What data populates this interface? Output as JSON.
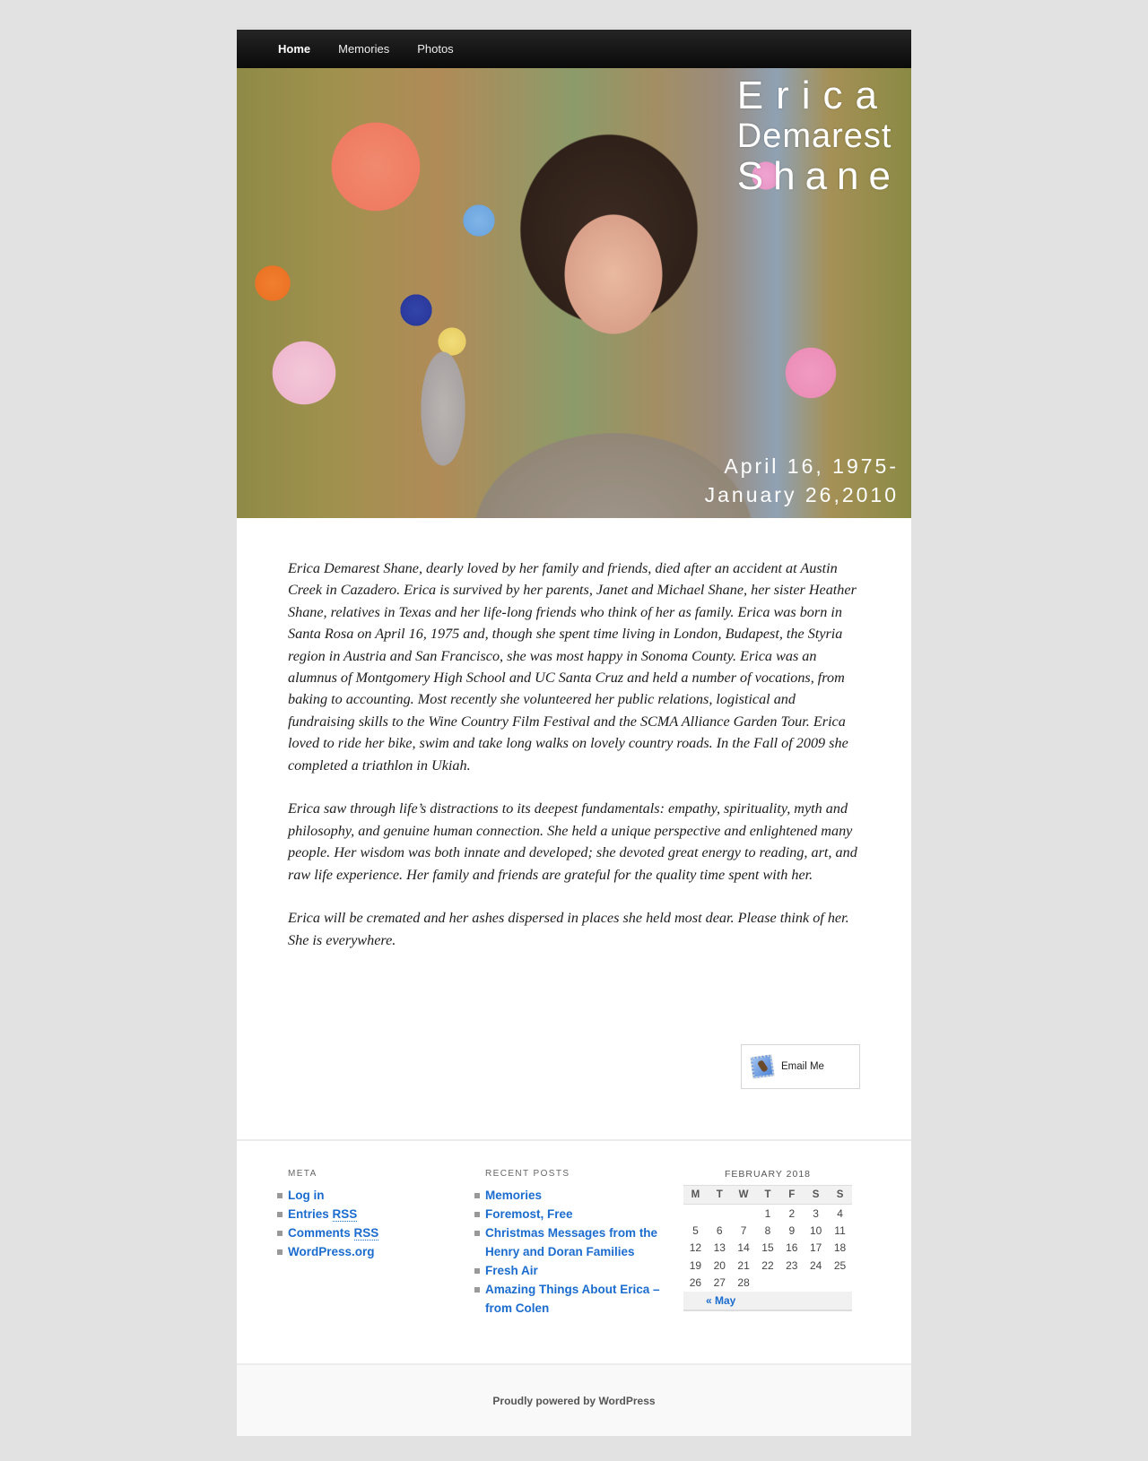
{
  "nav": {
    "items": [
      {
        "label": "Home",
        "current": true
      },
      {
        "label": "Memories",
        "current": false
      },
      {
        "label": "Photos",
        "current": false
      }
    ]
  },
  "header": {
    "title_line1": "Erica",
    "title_line2": "Demarest",
    "title_line3": "Shane",
    "dates_line1": "April 16, 1975-",
    "dates_line2": "January 26,2010"
  },
  "content": {
    "paragraphs": [
      "Erica Demarest Shane, dearly loved by her family and friends, died after an accident at Austin Creek in Cazadero. Erica is survived by her parents, Janet and Michael Shane, her sister Heather Shane, relatives in Texas and her life-long friends who think of her as family. Erica was born in Santa Rosa on April 16, 1975 and, though she spent time living in London, Budapest, the Styria region in Austria and San Francisco, she was most happy in Sonoma County. Erica was an alumnus of Montgomery High School and UC Santa Cruz and held a number of vocations, from baking to accounting. Most recently she volunteered her public relations, logistical and fundraising skills to the Wine Country Film Festival and the SCMA Alliance Garden Tour. Erica loved to ride her bike, swim and take long walks on lovely country roads. In the Fall of 2009 she completed a triathlon in Ukiah.",
      "Erica saw through life’s distractions to its deepest fundamentals: empathy, spirituality, myth and philosophy, and genuine human connection. She held a unique perspective and enlightened many people. Her wisdom was both innate and developed; she devoted great energy to reading, art, and raw life experience. Her family and friends are grateful for the quality time spent with her.",
      "Erica will be cremated and her ashes dispersed in places she held most dear. Please think of her. She is everywhere."
    ],
    "email_button": {
      "label": "Email Me",
      "icon": "mail-stamp-icon"
    }
  },
  "widgets": {
    "meta": {
      "title": "Meta",
      "items": [
        {
          "text": "Log in",
          "abbr": ""
        },
        {
          "text": "Entries ",
          "abbr": "RSS"
        },
        {
          "text": "Comments ",
          "abbr": "RSS"
        },
        {
          "text": "WordPress.org",
          "abbr": ""
        }
      ]
    },
    "recent_posts": {
      "title": "Recent Posts",
      "items": [
        "Memories",
        "Foremost, Free",
        "Christmas Messages from the Henry and Doran Families",
        "Fresh Air",
        "Amazing Things About Erica – from Colen"
      ]
    },
    "calendar": {
      "caption": "FEBRUARY 2018",
      "weekdays": [
        "M",
        "T",
        "W",
        "T",
        "F",
        "S",
        "S"
      ],
      "weeks": [
        [
          "",
          "",
          "",
          "1",
          "2",
          "3",
          "4"
        ],
        [
          "5",
          "6",
          "7",
          "8",
          "9",
          "10",
          "11"
        ],
        [
          "12",
          "13",
          "14",
          "15",
          "16",
          "17",
          "18"
        ],
        [
          "19",
          "20",
          "21",
          "22",
          "23",
          "24",
          "25"
        ],
        [
          "26",
          "27",
          "28",
          "",
          "",
          "",
          ""
        ]
      ],
      "prev_link": "« May"
    }
  },
  "footer": {
    "credit": "Proudly powered by WordPress"
  },
  "colors": {
    "link": "#1b6ccf",
    "nav_bg": "#0a0a0a",
    "page_bg": "#e2e2e2"
  }
}
